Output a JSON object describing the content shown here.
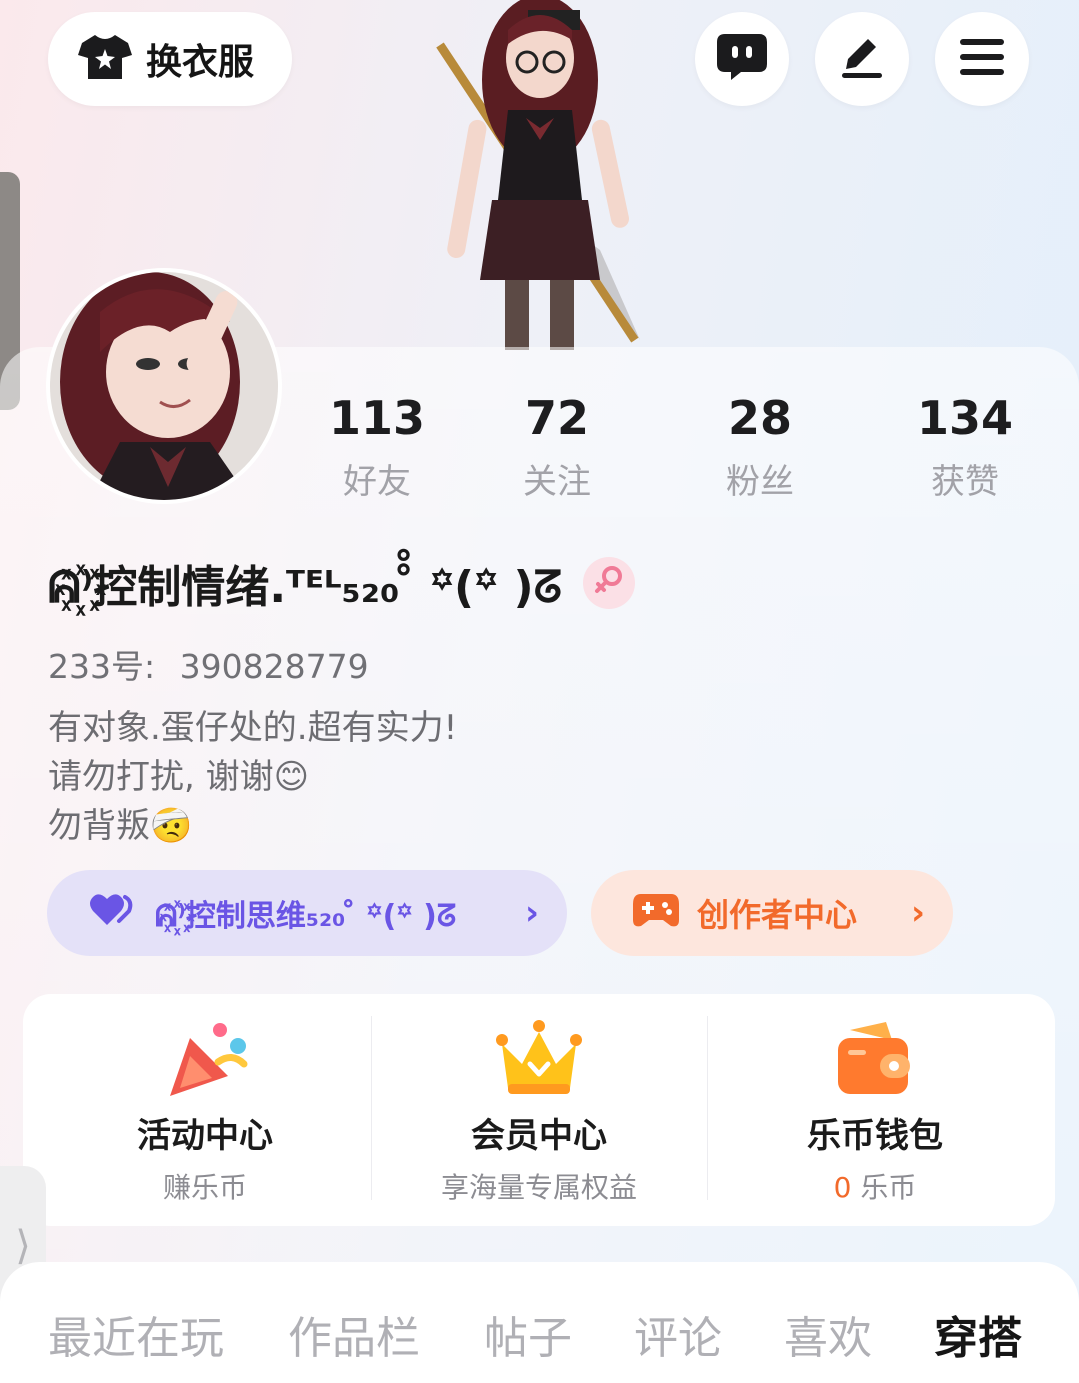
{
  "header": {
    "change_clothes_label": "换衣服",
    "icons": [
      "shirt-icon",
      "message-icon",
      "edit-icon",
      "menu-icon"
    ]
  },
  "stats": [
    {
      "value": "113",
      "label": "好友"
    },
    {
      "value": "72",
      "label": "关注"
    },
    {
      "value": "28",
      "label": "粉丝"
    },
    {
      "value": "134",
      "label": "获赞"
    }
  ],
  "profile": {
    "nickname": "ᕱ꙰⁾控制情绪.ᵀᴱᴸ₅₂₀ ̊̊ ꙳(꙳ )ᘔ",
    "gender_icon": "female-icon",
    "uid_label": "233号:",
    "uid_value": "390828779",
    "bio_line1": "有对象.蛋仔处的.超有实力!",
    "bio_line2": "请勿打扰, 谢谢😊",
    "bio_line3": "勿背叛🤕"
  },
  "chips": {
    "couple_label": "ᕱ꙰⁾控制思维₅₂₀ ̊̊ ꙳(꙳ )ᘔ",
    "creator_label": "创作者中心",
    "arrow": "›"
  },
  "services": [
    {
      "title": "活动中心",
      "sub": "赚乐币",
      "icon": "party-popper-icon"
    },
    {
      "title": "会员中心",
      "sub": "享海量专属权益",
      "icon": "crown-icon"
    },
    {
      "title": "乐币钱包",
      "sub_value": "0",
      "sub_unit": "乐币",
      "icon": "wallet-icon"
    }
  ],
  "tabs": [
    {
      "label": "最近在玩",
      "active": false
    },
    {
      "label": "作品栏",
      "active": false
    },
    {
      "label": "帖子",
      "active": false
    },
    {
      "label": "评论",
      "active": false
    },
    {
      "label": "喜欢",
      "active": false
    },
    {
      "label": "穿搭",
      "active": true
    }
  ],
  "left_tab_glyph": "⟩",
  "colors": {
    "accent_orange": "#f26a2b",
    "accent_purple": "#6a55e5",
    "gender_pink": "#f07a96"
  }
}
